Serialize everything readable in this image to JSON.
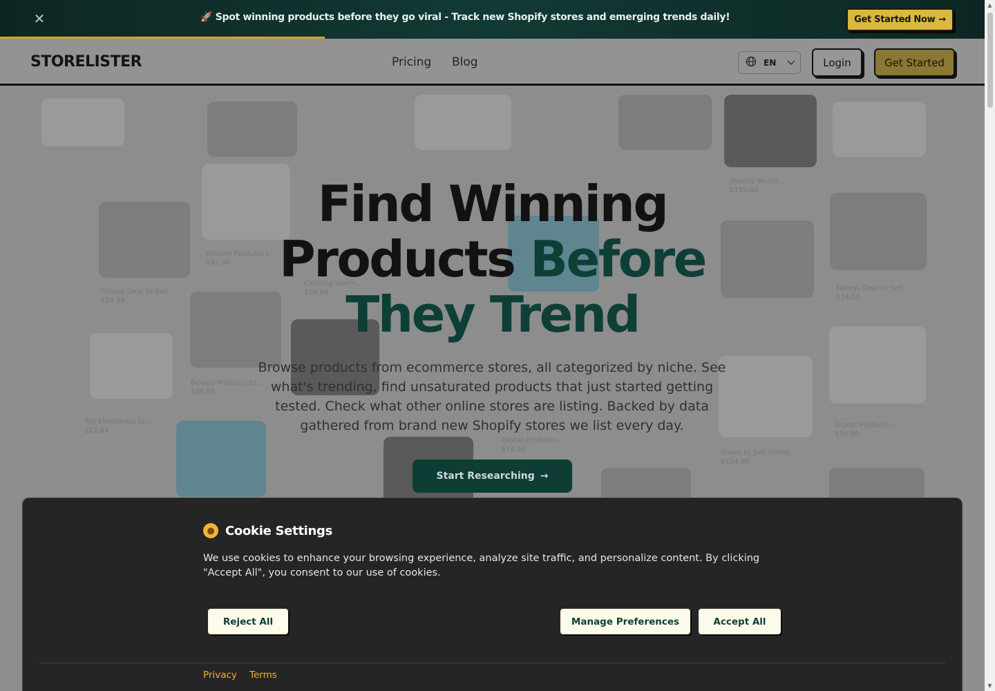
{
  "announcement": {
    "close_icon": "close-icon",
    "message": "🚀 Spot winning products before they go viral - Track new Shopify stores and emerging trends daily!",
    "cta_label": "Get Started Now",
    "cta_arrow": "→",
    "progress": 0.33
  },
  "nav": {
    "brand": "STORELISTER",
    "links": [
      "Pricing",
      "Blog"
    ],
    "language": "EN",
    "login_label": "Login",
    "get_started_label": "Get Started"
  },
  "hero": {
    "headline_line1": "Find Winning",
    "headline_line2_plain": "Products ",
    "headline_line2_accent": "Before",
    "headline_line3_accent": "They Trend",
    "subtitle": "Browse products from ecommerce stores, all categorized by niche. See what's trending, find unsaturated products that just started getting tested. Check what other online stores are listing. Backed by data gathered from brand new Shopify stores we list every day.",
    "cta_label": "Start Researching",
    "cta_arrow": "→"
  },
  "background_cards": [
    {
      "caption": "Kitchen Products t...",
      "price": "$42.00"
    },
    {
      "caption": "Clothing Worth...",
      "price": "$64.99"
    },
    {
      "caption": "Jewelry Worth...",
      "price": "$159.00"
    },
    {
      "caption": "Fitness Gear to Sell",
      "price": "$24.99"
    },
    {
      "caption": "Beauty Products to...",
      "price": "$38.95"
    },
    {
      "caption": "Top Electronics to...",
      "price": "$22.99"
    },
    {
      "caption": "Digital Products...",
      "price": "$74.50"
    },
    {
      "caption": "Shoes to Sell Online",
      "price": "$154.99"
    },
    {
      "caption": "Fitness Gear to Sell",
      "price": "$34.00"
    },
    {
      "caption": "Digital Products...",
      "price": "$74.50"
    }
  ],
  "cookie": {
    "title": "Cookie Settings",
    "icon": "cookie-icon",
    "text": "We use cookies to enhance your browsing experience, analyze site traffic, and personalize content. By clicking \"Accept All\", you consent to our use of cookies.",
    "reject_label": "Reject All",
    "manage_label": "Manage Preferences",
    "accept_label": "Accept All",
    "privacy_label": "Privacy",
    "terms_label": "Terms"
  },
  "colors": {
    "accent_green": "#0e3f36",
    "accent_gold": "#d9b83f",
    "cookie_link": "#f3b51f"
  }
}
